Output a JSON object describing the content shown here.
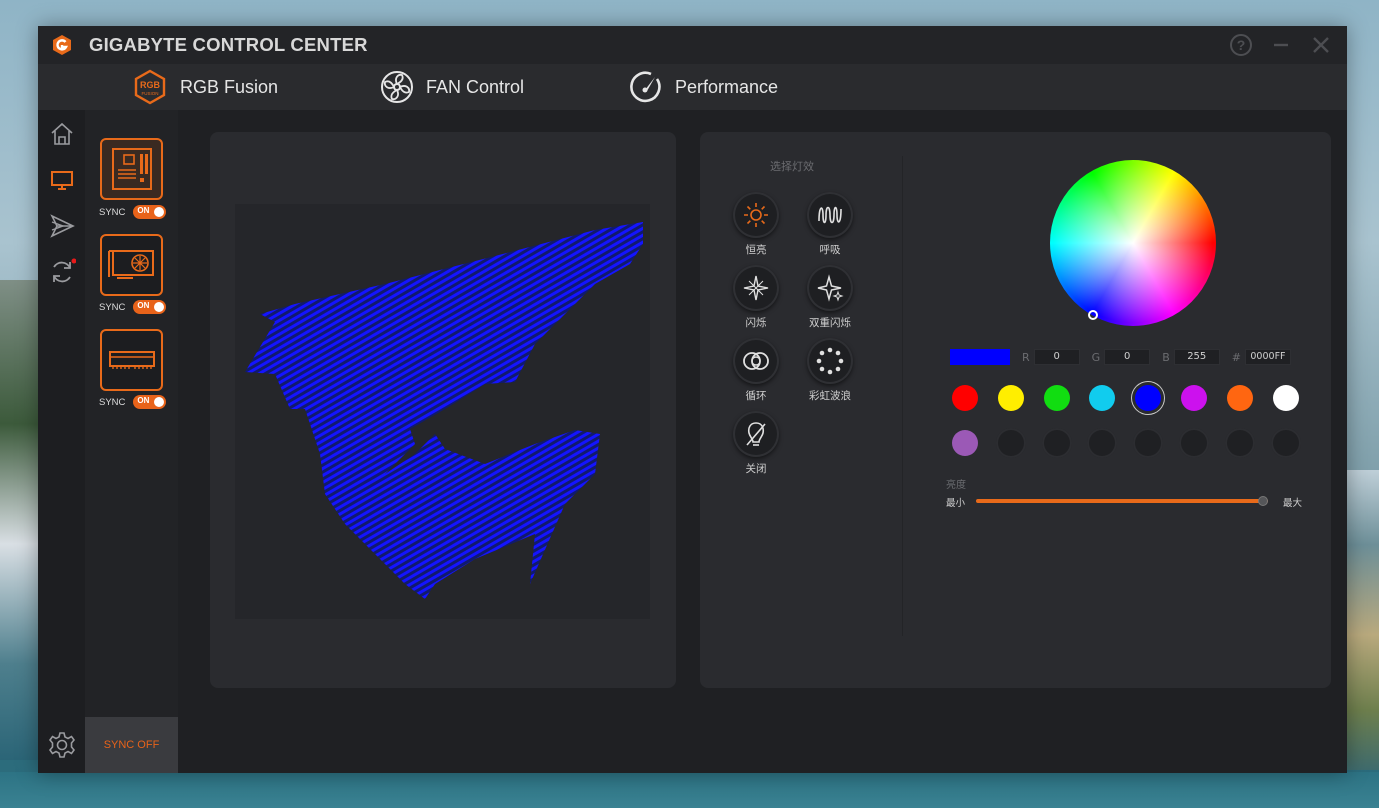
{
  "window": {
    "title": "GIGABYTE CONTROL CENTER",
    "controls": {
      "help": "?",
      "minimize": "−",
      "close": "✕"
    }
  },
  "tabs": [
    {
      "label": "RGB Fusion",
      "icon": "rgb-fusion-icon",
      "badge_top": "RGB",
      "badge_bottom": "FUSION"
    },
    {
      "label": "FAN Control",
      "icon": "fan-icon"
    },
    {
      "label": "Performance",
      "icon": "performance-gauge-icon"
    }
  ],
  "nav": [
    "home-icon",
    "monitor-icon",
    "send-icon",
    "update-icon",
    "settings-icon"
  ],
  "devices": [
    {
      "name": "motherboard",
      "icon": "motherboard-icon",
      "sync_label": "SYNC",
      "toggle": "ON",
      "active": true
    },
    {
      "name": "graphics-card",
      "icon": "gpu-icon",
      "sync_label": "SYNC",
      "toggle": "ON",
      "active": false
    },
    {
      "name": "memory",
      "icon": "ram-icon",
      "sync_label": "SYNC",
      "toggle": "ON",
      "active": false
    }
  ],
  "sync_off_label": "SYNC OFF",
  "effects": {
    "heading": "选择灯效",
    "items": [
      {
        "label": "恒亮",
        "icon": "sun-icon",
        "active": true
      },
      {
        "label": "呼吸",
        "icon": "breathing-wave-icon"
      },
      {
        "label": "闪烁",
        "icon": "flash-star-icon"
      },
      {
        "label": "双重闪烁",
        "icon": "double-flash-icon"
      },
      {
        "label": "循环",
        "icon": "cycle-icon"
      },
      {
        "label": "彩虹波浪",
        "icon": "rainbow-wave-icon"
      },
      {
        "label": "关闭",
        "icon": "off-icon"
      }
    ]
  },
  "color": {
    "current_hex_color": "#0000FF",
    "r_label": "R",
    "r": "0",
    "g_label": "G",
    "g": "0",
    "b_label": "B",
    "b": "255",
    "hex_label": "#",
    "hex": "0000FF",
    "presets": [
      "#ff0000",
      "#ffee00",
      "#11dd11",
      "#11ccee",
      "#0000ff",
      "#cc11ee",
      "#ff6611",
      "#ffffff",
      "#9b59b6"
    ],
    "selected_preset": 4,
    "empty_slots": 7
  },
  "brightness": {
    "title": "亮度",
    "min_label": "最小",
    "max_label": "最大",
    "value": 1.0
  },
  "accent": "#e86a1a",
  "preview_color": "#0000ff"
}
